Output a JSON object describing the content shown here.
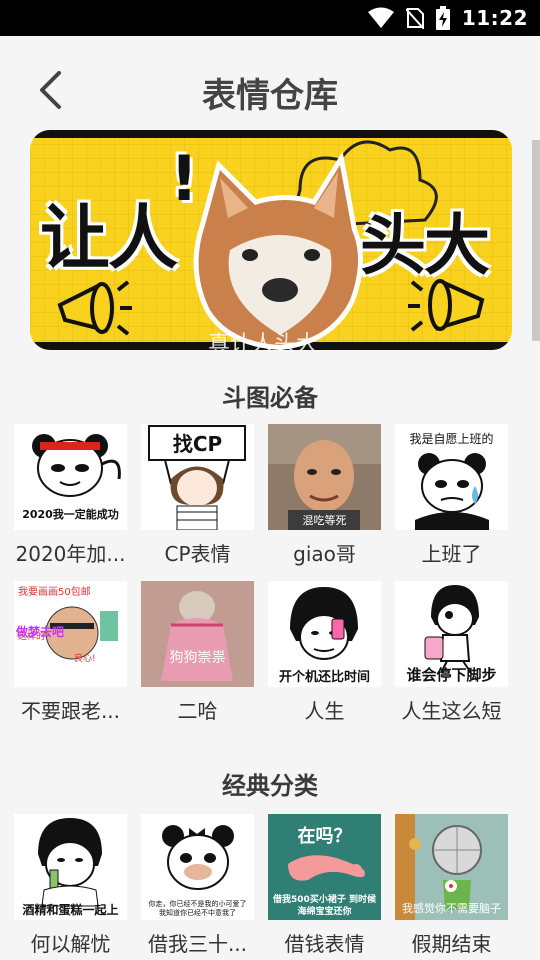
{
  "status_bar": {
    "time": "11:22"
  },
  "header": {
    "title": "表情仓库"
  },
  "banner": {
    "left_text": "让人",
    "exclaim": "!",
    "right_text": "头大",
    "caption": "真让人头大"
  },
  "sections": [
    {
      "title": "斗图必备",
      "items": [
        {
          "label": "2020年加...",
          "caption": "2020我一定能成功"
        },
        {
          "label": "CP表情",
          "caption": "找CP"
        },
        {
          "label": "giao哥",
          "caption": "混吃等死"
        },
        {
          "label": "上班了",
          "caption": "我是自愿上班的"
        },
        {
          "label": "不要跟老...",
          "caption": "做梦去吧"
        },
        {
          "label": "二哈",
          "caption": "狗狗崇祟"
        },
        {
          "label": "人生",
          "caption": "开个机还比时间"
        },
        {
          "label": "人生这么短",
          "caption": "谁会停下脚步"
        }
      ]
    },
    {
      "title": "经典分类",
      "items": [
        {
          "label": "何以解忧",
          "caption": "酒精和蛋糕一起上"
        },
        {
          "label": "借我三十...",
          "caption": "你走，你已经不是我的小可爱了 我知道你已经不中意我了"
        },
        {
          "label": "借钱表情",
          "caption_top": "在吗？",
          "caption": "借我500买小裙子 到时候海绵宝宝还你"
        },
        {
          "label": "假期结束",
          "caption": "我感觉你不需要脑子"
        }
      ]
    }
  ],
  "colors": {
    "banner_yellow": "#f8d21e",
    "background": "#f5f5f5"
  }
}
